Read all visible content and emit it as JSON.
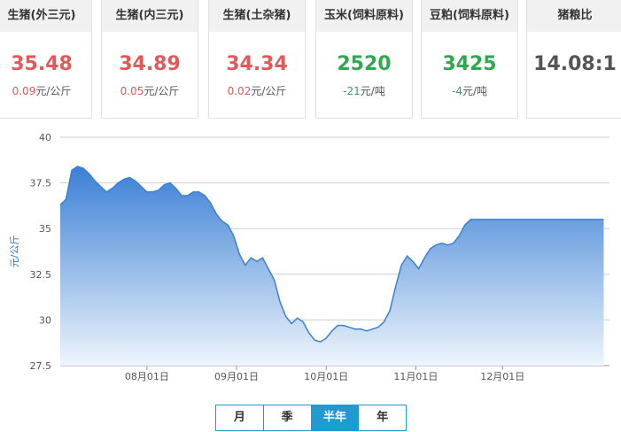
{
  "cards": [
    {
      "title": "生猪(外三元)",
      "price": "35.48",
      "change_num": "0.09",
      "change_unit": "元/公斤",
      "color": "red"
    },
    {
      "title": "生猪(内三元)",
      "price": "34.89",
      "change_num": "0.05",
      "change_unit": "元/公斤",
      "color": "red"
    },
    {
      "title": "生猪(土杂猪)",
      "price": "34.34",
      "change_num": "0.02",
      "change_unit": "元/公斤",
      "color": "red"
    },
    {
      "title": "玉米(饲料原料)",
      "price": "2520",
      "change_num": "-21",
      "change_unit": "元/吨",
      "color": "green"
    },
    {
      "title": "豆粕(饲料原料)",
      "price": "3425",
      "change_num": "-4",
      "change_unit": "元/吨",
      "color": "green"
    },
    {
      "title": "猪粮比",
      "price": "14.08:1",
      "change_num": "",
      "change_unit": "",
      "color": "gray"
    }
  ],
  "tabs": {
    "items": [
      "月",
      "季",
      "半年",
      "年"
    ],
    "active": 2
  },
  "colors": {
    "line": "#3b7fd4",
    "fill_top": "#3b7fd4",
    "fill_bottom": "#eef5fc",
    "grid": "#cfcfcf",
    "red": "#e05a5a",
    "green": "#2fa84f",
    "tab_border": "#1f9bd0"
  },
  "chart_data": {
    "type": "area",
    "ylabel": "元/公斤",
    "ylim": [
      27.5,
      40
    ],
    "yticks": [
      "27.5",
      "30",
      "32.5",
      "35",
      "37.5",
      "40"
    ],
    "xtick_labels": [
      "08月01日",
      "09月01日",
      "10月01日",
      "11月01日",
      "12月01日"
    ],
    "xtick_days": [
      30,
      61,
      92,
      123,
      153
    ],
    "xlim_days": [
      0,
      190
    ],
    "x_days": [
      0,
      2,
      4,
      6,
      8,
      10,
      12,
      14,
      16,
      18,
      20,
      22,
      24,
      26,
      28,
      30,
      32,
      34,
      36,
      38,
      40,
      42,
      44,
      46,
      48,
      50,
      52,
      54,
      56,
      58,
      60,
      62,
      64,
      66,
      68,
      70,
      72,
      74,
      76,
      78,
      80,
      82,
      84,
      86,
      88,
      90,
      92,
      94,
      96,
      98,
      100,
      102,
      104,
      106,
      108,
      110,
      112,
      114,
      116,
      118,
      120,
      122,
      124,
      126,
      128,
      130,
      132,
      134,
      136,
      138,
      140,
      142,
      144,
      146,
      148,
      150,
      152,
      154,
      156,
      158,
      160,
      162,
      164,
      166,
      168,
      170,
      172,
      174,
      176,
      178,
      180,
      182,
      184,
      186,
      188
    ],
    "values": [
      36.3,
      36.6,
      38.2,
      38.4,
      38.3,
      38.0,
      37.6,
      37.3,
      37.0,
      37.2,
      37.5,
      37.7,
      37.8,
      37.6,
      37.3,
      37.0,
      37.0,
      37.1,
      37.4,
      37.5,
      37.2,
      36.8,
      36.8,
      37.0,
      37.0,
      36.8,
      36.4,
      35.8,
      35.4,
      35.2,
      34.6,
      33.6,
      33.0,
      33.4,
      33.2,
      33.4,
      32.8,
      32.2,
      31.0,
      30.2,
      29.8,
      30.1,
      29.9,
      29.3,
      28.9,
      28.8,
      29.0,
      29.4,
      29.7,
      29.7,
      29.6,
      29.5,
      29.5,
      29.4,
      29.5,
      29.6,
      29.9,
      30.5,
      31.8,
      33.0,
      33.5,
      33.2,
      32.8,
      33.4,
      33.9,
      34.1,
      34.2,
      34.1,
      34.2,
      34.6,
      35.2,
      35.5,
      35.5,
      35.5,
      35.5,
      35.5,
      35.5,
      35.5,
      35.5,
      35.5,
      35.5,
      35.5,
      35.5,
      35.5,
      35.5,
      35.5,
      35.5,
      35.5,
      35.5,
      35.5,
      35.5,
      35.5,
      35.5,
      35.5,
      35.5
    ],
    "grid": true
  }
}
